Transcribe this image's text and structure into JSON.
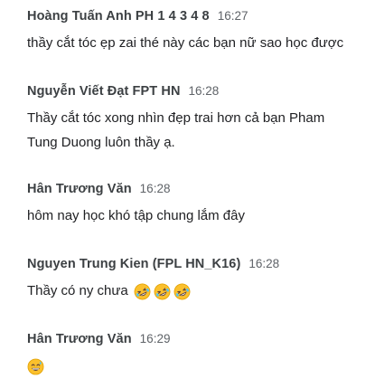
{
  "messages": [
    {
      "author": "Hoàng Tuấn Anh PH 1 4 3 4 8",
      "time": "16:27",
      "text": "thầy cắt tóc ẹp zai thé này các bạn nữ sao học được"
    },
    {
      "author": "Nguyễn Viết Đạt FPT HN",
      "time": "16:28",
      "text_line1": "Thầy cắt tóc xong nhìn đẹp trai hơn cả bạn Pham",
      "text_line2": "Tung Duong luôn thầy ạ."
    },
    {
      "author": "Hân Trương Văn",
      "time": "16:28",
      "text": "hôm nay học khó tập chung lắm đây"
    },
    {
      "author": "Nguyen Trung Kien (FPL HN_K16)",
      "time": "16:28",
      "text": "Thầy có ny chưa",
      "emojis": [
        "rolling-on-floor-laughing-emoji",
        "rolling-on-floor-laughing-emoji",
        "rolling-on-floor-laughing-emoji"
      ]
    },
    {
      "author": "Hân Trương Văn",
      "time": "16:29",
      "emojis": [
        "grinning-sweat-emoji"
      ]
    }
  ],
  "colors": {
    "author": "#3c4043",
    "time": "#5f6368",
    "text": "#202124",
    "emoji_face": "#fbc02d"
  }
}
